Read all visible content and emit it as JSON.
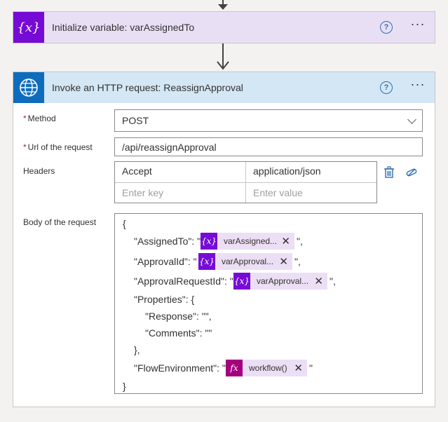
{
  "var_card": {
    "title": "Initialize variable: varAssignedTo",
    "icon_label": "{x}",
    "help_label": "?",
    "more_label": "···"
  },
  "http_card": {
    "title": "Invoke an HTTP request: ReassignApproval",
    "help_label": "?",
    "more_label": "···",
    "method": {
      "required_mark": "*",
      "label": "Method",
      "value": "POST"
    },
    "url": {
      "required_mark": "*",
      "label": "Url of the request",
      "value": "/api/reassignApproval"
    },
    "headers": {
      "label": "Headers",
      "rows": [
        {
          "key": "Accept",
          "value": "application/json"
        }
      ],
      "key_placeholder": "Enter key",
      "value_placeholder": "Enter value"
    },
    "body": {
      "label": "Body of the request",
      "open_brace": "{",
      "assigned_key": "\"AssignedTo\": \"",
      "assigned_token": "varAssigned...",
      "assigned_end": "\",",
      "approval_key": "\"ApprovalId\": \"",
      "approval_token": "varApproval...",
      "approval_end": "\",",
      "request_key": "\"ApprovalRequestId\": \"",
      "request_token": "varApproval...",
      "request_end": "\",",
      "properties_open": "\"Properties\": {",
      "response_line": "\"Response\": \"\",",
      "comments_line": "\"Comments\": \"\"",
      "properties_close": "},",
      "flow_key": "\"FlowEnvironment\": \"",
      "flow_token": "workflow()",
      "flow_end": "\"",
      "close_brace": "}",
      "var_icon_label": "{x}",
      "fx_icon_label": "fx",
      "remove_label": "✕"
    }
  },
  "colors": {
    "variable_accent": "#770bd6",
    "http_accent": "#0f6cbd",
    "expression_accent": "#a4007e"
  }
}
